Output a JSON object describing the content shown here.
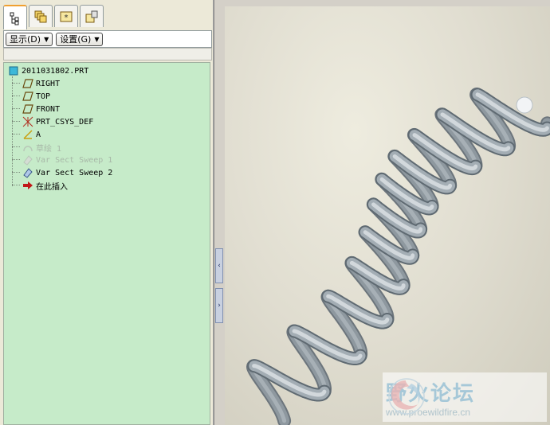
{
  "left_panel": {
    "tabs": [
      {
        "icon": "model-tree-icon",
        "active": true
      },
      {
        "icon": "layers-icon",
        "active": false
      },
      {
        "icon": "favorites-icon",
        "active": false
      },
      {
        "icon": "tools-icon",
        "active": false
      }
    ],
    "show_dropdown": "显示(D)",
    "settings_dropdown": "设置(G)",
    "tree": {
      "root": "2011031802.PRT",
      "items": [
        {
          "label": "RIGHT",
          "icon": "datum-plane-icon",
          "dim": false
        },
        {
          "label": "TOP",
          "icon": "datum-plane-icon",
          "dim": false
        },
        {
          "label": "FRONT",
          "icon": "datum-plane-icon",
          "dim": false
        },
        {
          "label": "PRT_CSYS_DEF",
          "icon": "coordinate-system-icon",
          "dim": false
        },
        {
          "label": "A",
          "icon": "datum-axis-icon",
          "dim": false
        },
        {
          "label": "草绘 1",
          "icon": "sketch-icon",
          "dim": true
        },
        {
          "label": "Var Sect Sweep 1",
          "icon": "sweep-icon",
          "dim": true
        },
        {
          "label": "Var Sect Sweep 2",
          "icon": "sweep-icon",
          "dim": false
        },
        {
          "label": "在此插入",
          "icon": "insert-arrow-icon",
          "dim": false
        }
      ]
    }
  },
  "splitter": {
    "collapse_label": "‹",
    "expand_label": "›"
  },
  "watermark": {
    "title": "野火论坛",
    "url": "www.proewildfire.cn"
  },
  "colors": {
    "tree_bg": "#c6ebc9",
    "spring": "#9aa6ae",
    "viewport_bg": "#e0ddd0"
  }
}
